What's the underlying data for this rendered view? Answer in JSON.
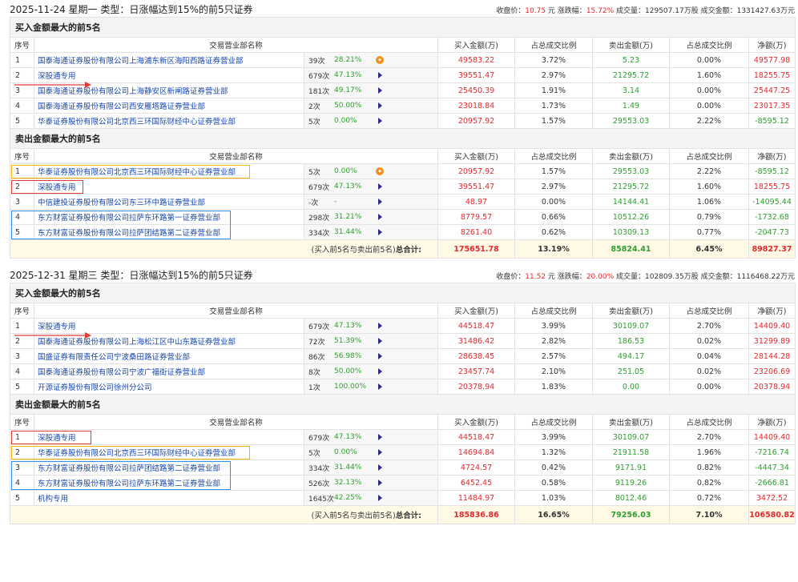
{
  "col_headers": [
    "序号",
    "交易营业部名称",
    "买入金额(万)",
    "占总成交比例",
    "卖出金额(万)",
    "占总成交比例",
    "净额(万)"
  ],
  "buy_section_title": "买入金额最大的前5名",
  "sell_section_title": "卖出金额最大的前5名",
  "total_label_prefix": "(买入前5名与卖出前5名)",
  "total_label_bold": "总合计:",
  "blocks": [
    {
      "title": "2025-11-24 星期一 类型：日涨幅达到15%的前5只证券",
      "stats": {
        "close_label": "收盘价：",
        "close_value": "10.75",
        "close_unit": " 元",
        "chg_label": "涨跌幅：",
        "chg_value": "15.72%",
        "vol_label": "成交量：",
        "vol_value": "129507.17万股",
        "amt_label": "成交金额：",
        "amt_value": "1331427.63万元"
      },
      "buy_rows": [
        {
          "idx": "1",
          "name": "国泰海通证券股份有限公司上海浦东新区海阳西路证券营业部",
          "count": "39次",
          "rate": "28.21%",
          "icon": "dot",
          "buy": "49583.22",
          "buy_pct": "3.72%",
          "sell": "5.23",
          "sell_pct": "0.00%",
          "net": "49577.98"
        },
        {
          "idx": "2",
          "name": "深股通专用",
          "count": "679次",
          "rate": "47.13%",
          "icon": "tri",
          "buy": "39551.47",
          "buy_pct": "2.97%",
          "sell": "21295.72",
          "sell_pct": "1.60%",
          "net": "18255.75"
        },
        {
          "idx": "3",
          "name": "国泰海通证券股份有限公司上海静安区新闸路证券营业部",
          "count": "181次",
          "rate": "49.17%",
          "icon": "tri",
          "buy": "25450.39",
          "buy_pct": "1.91%",
          "sell": "3.14",
          "sell_pct": "0.00%",
          "net": "25447.25"
        },
        {
          "idx": "4",
          "name": "国泰海通证券股份有限公司西安雁塔路证券营业部",
          "count": "2次",
          "rate": "50.00%",
          "icon": "tri",
          "buy": "23018.84",
          "buy_pct": "1.73%",
          "sell": "1.49",
          "sell_pct": "0.00%",
          "net": "23017.35"
        },
        {
          "idx": "5",
          "name": "华泰证券股份有限公司北京西三环国际财经中心证券营业部",
          "count": "5次",
          "rate": "0.00%",
          "icon": "tri",
          "buy": "20957.92",
          "buy_pct": "1.57%",
          "sell": "29553.03",
          "sell_pct": "2.22%",
          "net": "-8595.12"
        }
      ],
      "sell_rows": [
        {
          "idx": "1",
          "name": "华泰证券股份有限公司北京西三环国际财经中心证券营业部",
          "count": "5次",
          "rate": "0.00%",
          "icon": "dot",
          "buy": "20957.92",
          "buy_pct": "1.57%",
          "sell": "29553.03",
          "sell_pct": "2.22%",
          "net": "-8595.12"
        },
        {
          "idx": "2",
          "name": "深股通专用",
          "count": "679次",
          "rate": "47.13%",
          "icon": "tri",
          "buy": "39551.47",
          "buy_pct": "2.97%",
          "sell": "21295.72",
          "sell_pct": "1.60%",
          "net": "18255.75"
        },
        {
          "idx": "3",
          "name": "中信建投证券股份有限公司东三环中路证券营业部",
          "count": "-次",
          "rate": "-",
          "icon": "tri",
          "buy": "48.97",
          "buy_pct": "0.00%",
          "sell": "14144.41",
          "sell_pct": "1.06%",
          "net": "-14095.44"
        },
        {
          "idx": "4",
          "name": "东方财富证券股份有限公司拉萨东环路第一证券营业部",
          "count": "298次",
          "rate": "31.21%",
          "icon": "tri",
          "buy": "8779.57",
          "buy_pct": "0.66%",
          "sell": "10512.26",
          "sell_pct": "0.79%",
          "net": "-1732.68"
        },
        {
          "idx": "5",
          "name": "东方财富证券股份有限公司拉萨团结路第二证券营业部",
          "count": "334次",
          "rate": "31.44%",
          "icon": "tri",
          "buy": "8261.40",
          "buy_pct": "0.62%",
          "sell": "10309.13",
          "sell_pct": "0.77%",
          "net": "-2047.73"
        }
      ],
      "total": {
        "buy": "175651.78",
        "buy_pct": "13.19%",
        "sell": "85824.41",
        "sell_pct": "6.45%",
        "net": "89827.37"
      }
    },
    {
      "title": "2025-12-31 星期三 类型：日涨幅达到15%的前5只证券",
      "stats": {
        "close_label": "收盘价：",
        "close_value": "11.52",
        "close_unit": " 元",
        "chg_label": "涨跌幅：",
        "chg_value": "20.00%",
        "vol_label": "成交量：",
        "vol_value": "102809.35万股",
        "amt_label": "成交金额：",
        "amt_value": "1116468.22万元"
      },
      "buy_rows": [
        {
          "idx": "1",
          "name": "深股通专用",
          "count": "679次",
          "rate": "47.13%",
          "icon": "tri",
          "buy": "44518.47",
          "buy_pct": "3.99%",
          "sell": "30109.07",
          "sell_pct": "2.70%",
          "net": "14409.40"
        },
        {
          "idx": "2",
          "name": "国泰海通证券股份有限公司上海松江区中山东路证券营业部",
          "count": "72次",
          "rate": "51.39%",
          "icon": "tri",
          "buy": "31486.42",
          "buy_pct": "2.82%",
          "sell": "186.53",
          "sell_pct": "0.02%",
          "net": "31299.89"
        },
        {
          "idx": "3",
          "name": "国盛证券有限责任公司宁波桑田路证券营业部",
          "count": "86次",
          "rate": "56.98%",
          "icon": "tri",
          "buy": "28638.45",
          "buy_pct": "2.57%",
          "sell": "494.17",
          "sell_pct": "0.04%",
          "net": "28144.28"
        },
        {
          "idx": "4",
          "name": "国泰海通证券股份有限公司宁波广福街证券营业部",
          "count": "8次",
          "rate": "50.00%",
          "icon": "tri",
          "buy": "23457.74",
          "buy_pct": "2.10%",
          "sell": "251.05",
          "sell_pct": "0.02%",
          "net": "23206.69"
        },
        {
          "idx": "5",
          "name": "开源证券股份有限公司徐州分公司",
          "count": "1次",
          "rate": "100.00%",
          "icon": "tri",
          "buy": "20378.94",
          "buy_pct": "1.83%",
          "sell": "0.00",
          "sell_pct": "0.00%",
          "net": "20378.94"
        }
      ],
      "sell_rows": [
        {
          "idx": "1",
          "name": "深股通专用",
          "count": "679次",
          "rate": "47.13%",
          "icon": "tri",
          "buy": "44518.47",
          "buy_pct": "3.99%",
          "sell": "30109.07",
          "sell_pct": "2.70%",
          "net": "14409.40"
        },
        {
          "idx": "2",
          "name": "华泰证券股份有限公司北京西三环国际财经中心证券营业部",
          "count": "5次",
          "rate": "0.00%",
          "icon": "tri",
          "buy": "14694.84",
          "buy_pct": "1.32%",
          "sell": "21911.58",
          "sell_pct": "1.96%",
          "net": "-7216.74"
        },
        {
          "idx": "3",
          "name": "东方财富证券股份有限公司拉萨团结路第二证券营业部",
          "count": "334次",
          "rate": "31.44%",
          "icon": "tri",
          "buy": "4724.57",
          "buy_pct": "0.42%",
          "sell": "9171.91",
          "sell_pct": "0.82%",
          "net": "-4447.34"
        },
        {
          "idx": "4",
          "name": "东方财富证券股份有限公司拉萨东环路第二证券营业部",
          "count": "526次",
          "rate": "32.13%",
          "icon": "tri",
          "buy": "6452.45",
          "buy_pct": "0.58%",
          "sell": "9119.26",
          "sell_pct": "0.82%",
          "net": "-2666.81"
        },
        {
          "idx": "5",
          "name": "机构专用",
          "count": "1645次",
          "rate": "42.25%",
          "icon": "tri",
          "buy": "11484.97",
          "buy_pct": "1.03%",
          "sell": "8012.46",
          "sell_pct": "0.72%",
          "net": "3472.52"
        }
      ],
      "total": {
        "buy": "185836.86",
        "buy_pct": "16.65%",
        "sell": "79256.03",
        "sell_pct": "7.10%",
        "net": "106580.82"
      }
    }
  ],
  "colors": {
    "red": "#e4292e",
    "green": "#2e9e2e",
    "link": "#1a47b0",
    "highlight_red": "#e03c3c",
    "highlight_yellow": "#f0b400",
    "highlight_blue": "#2f8fe6"
  },
  "icons": {
    "expand": "triangle-right-icon",
    "info": "orange-dot-icon"
  }
}
